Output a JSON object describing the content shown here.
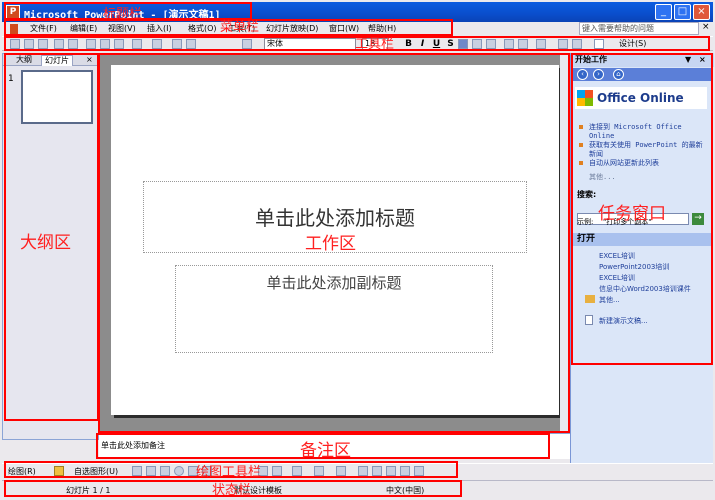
{
  "titlebar": {
    "app_icon": "P",
    "title": "Microsoft PowerPoint - [演示文稿1]",
    "min": "_",
    "max": "□",
    "close": "×"
  },
  "menu": {
    "items": [
      "文件(F)",
      "编辑(E)",
      "视图(V)",
      "插入(I)",
      "格式(O)",
      "工具(T)",
      "幻灯片放映(D)",
      "窗口(W)",
      "帮助(H)"
    ],
    "help_placeholder": "键入需要帮助的问题",
    "help_close": "×"
  },
  "toolbar": {
    "font": "宋体",
    "size": "18",
    "bold": "B",
    "italic": "I",
    "underline": "U",
    "shadow": "S",
    "design": "设计(S)",
    "icons": [
      "new-icon",
      "open-icon",
      "save-icon",
      "print-icon",
      "preview-icon",
      "cut-icon",
      "copy-icon",
      "paste-icon",
      "undo-icon",
      "redo-icon",
      "chart-icon",
      "table-icon",
      "zoom-icon"
    ]
  },
  "left_panel": {
    "tabs": [
      "大纲",
      "幻灯片"
    ],
    "tab_close": "×",
    "slide_number": "1"
  },
  "slide": {
    "title_placeholder": "单击此处添加标题",
    "subtitle_placeholder": "单击此处添加副标题"
  },
  "notes": {
    "placeholder": "单击此处添加备注"
  },
  "task_pane": {
    "header": "开始工作",
    "header_arrow": "▼",
    "header_close": "×",
    "nav_icons": [
      "back-icon",
      "forward-icon",
      "home-icon"
    ],
    "nav_glyphs": [
      "‹",
      "›",
      "⌂"
    ],
    "logo_text": "Office Online",
    "links": [
      "连接到 Microsoft Office Online",
      "获取有关使用 PowerPoint 的最新新闻",
      "自动从网站更新此列表"
    ],
    "more_1": "其他...",
    "search_label": "搜索:",
    "search_go": "→",
    "example_label": "示例:",
    "example_text": "\"打印多个副本\"",
    "open_section": "打开",
    "files": [
      "EXCEL培训",
      "PowerPoint2003培训",
      "EXCEL培训",
      "信息中心Word2003培训课件"
    ],
    "more_2": "其他...",
    "new_presentation": "新建演示文稿..."
  },
  "drawbar": {
    "draw": "绘图(R)",
    "autoshapes": "自选图形(U)"
  },
  "statusbar": {
    "slide_count": "幻灯片 1 / 1",
    "template": "默认设计模板",
    "language": "中文(中国)"
  },
  "annotations": {
    "title_bar": "标题栏",
    "menu_bar": "菜单栏",
    "toolbar": "工具栏",
    "outline": "大纲区",
    "work": "工作区",
    "task_window": "任务窗口",
    "notes": "备注区",
    "draw_toolbar": "绘图工具栏",
    "status": "状态栏"
  },
  "colors": {
    "title_blue": "#0a4ecc",
    "annotation_red": "#ff0000",
    "work_gray": "#8c8c8c",
    "taskpane_bg": "#dbe6f8"
  }
}
